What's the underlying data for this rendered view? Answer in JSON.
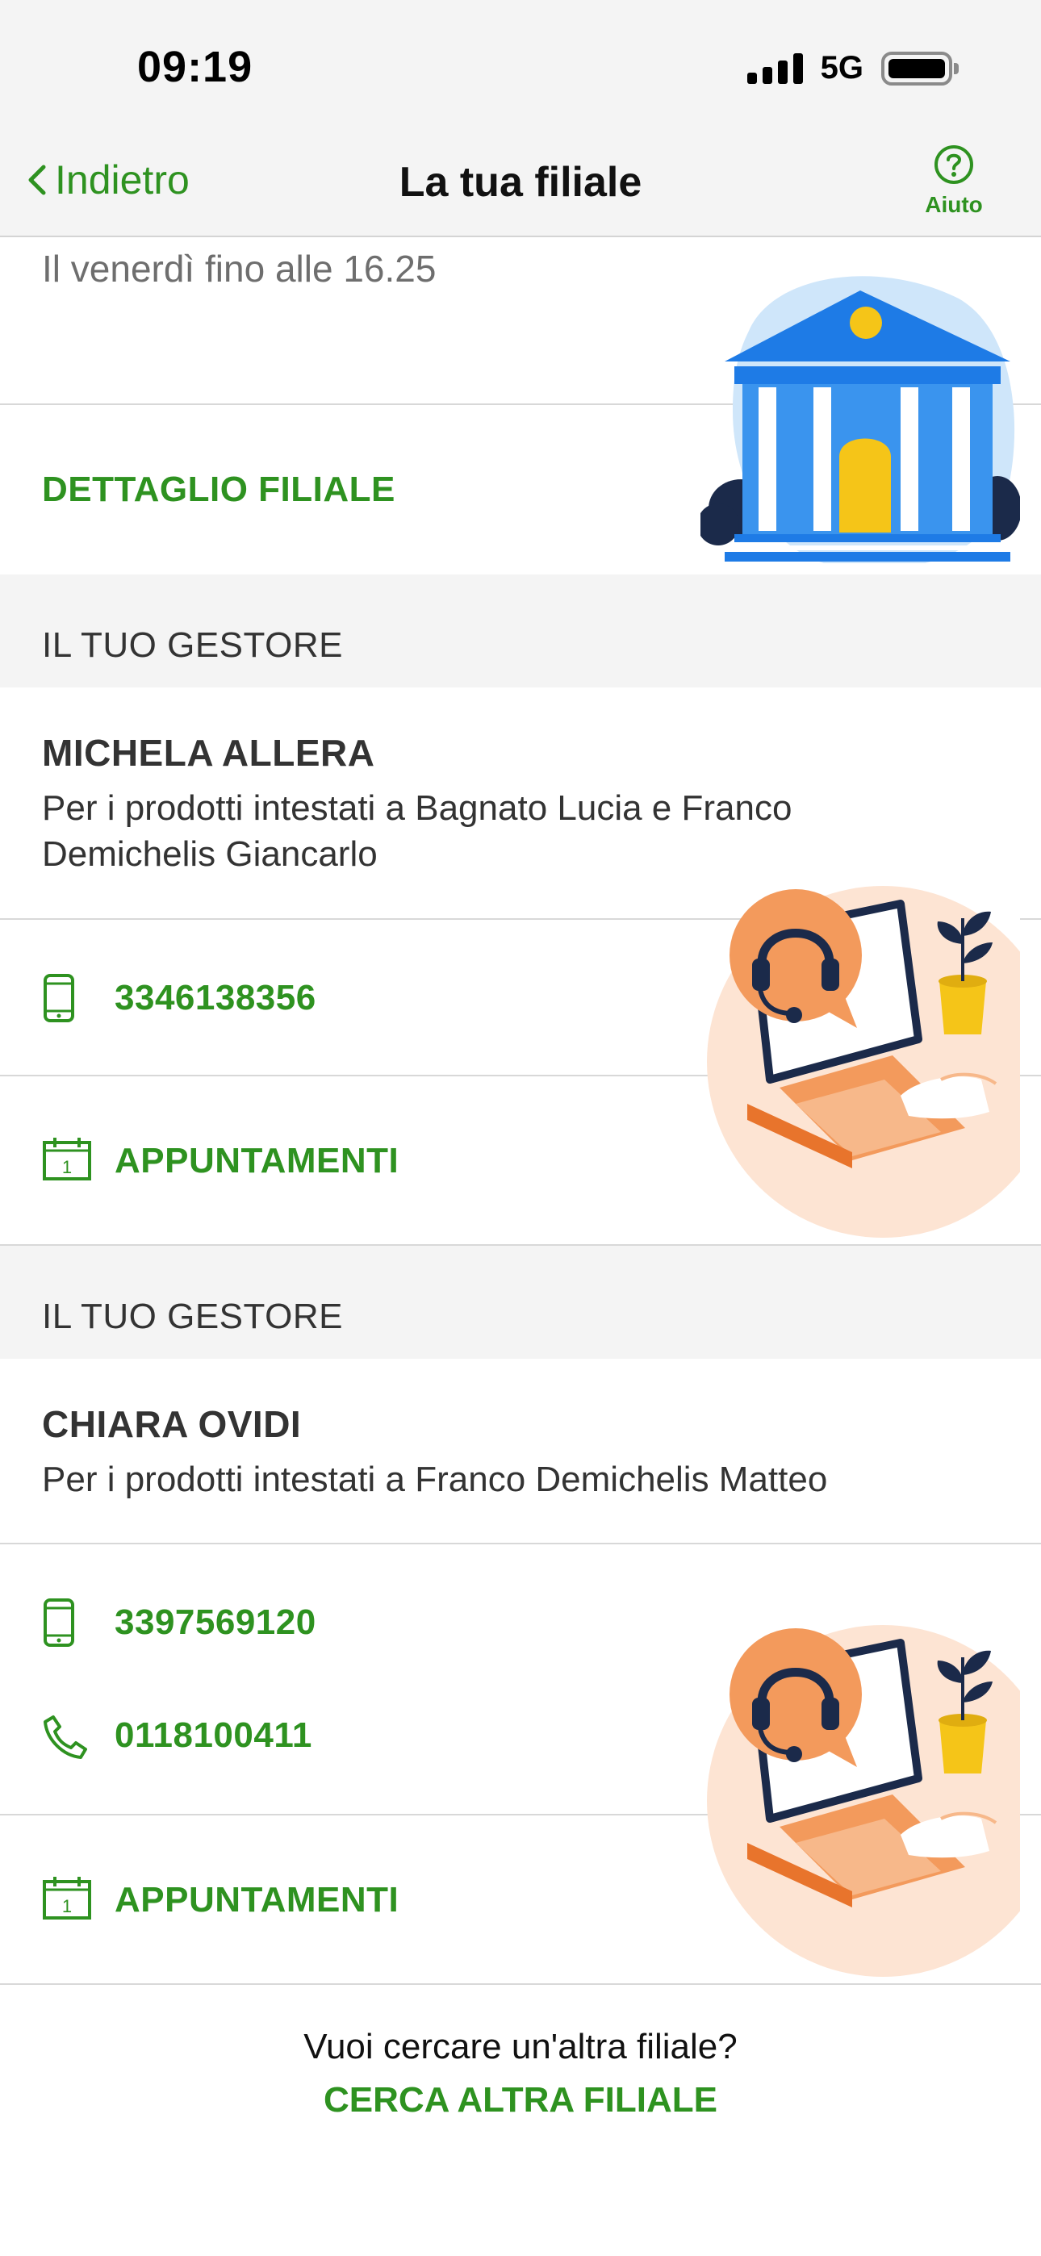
{
  "status_bar": {
    "time": "09:19",
    "network": "5G"
  },
  "nav": {
    "back_label": "Indietro",
    "title": "La tua filiale",
    "help_label": "Aiuto"
  },
  "branch": {
    "hours_text": "Il venerdì fino alle 16.25",
    "detail_link": "DETTAGLIO FILIALE"
  },
  "managers": [
    {
      "section_title": "IL TUO GESTORE",
      "name": "MICHELA ALLERA",
      "description_line1": "Per i prodotti intestati a Bagnato Lucia e Franco",
      "description_line2": "Demichelis Giancarlo",
      "mobile": "3346138356",
      "appointments_label": "APPUNTAMENTI"
    },
    {
      "section_title": "IL TUO GESTORE",
      "name": "CHIARA OVIDI",
      "description_line1": "Per i prodotti intestati a Franco Demichelis Matteo",
      "mobile": "3397569120",
      "phone": "0118100411",
      "appointments_label": "APPUNTAMENTI"
    }
  ],
  "footer": {
    "question": "Vuoi cercare un'altra filiale?",
    "search_link": "CERCA ALTRA FILIALE"
  },
  "colors": {
    "accent_green": "#2e9220",
    "background_gray": "#f4f4f4",
    "bank_blue": "#1e7be6",
    "illustration_orange": "#f39a5c"
  }
}
